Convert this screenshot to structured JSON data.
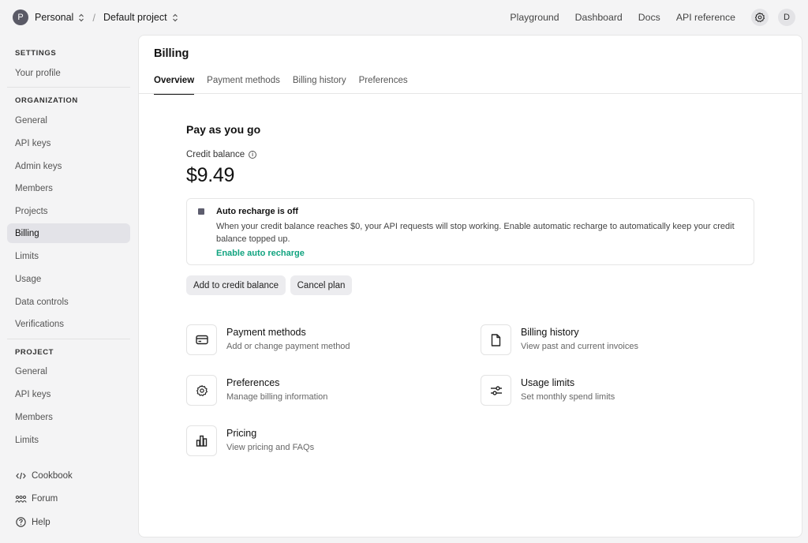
{
  "topbar": {
    "org_initial": "P",
    "org_name": "Personal",
    "project_name": "Default project",
    "crumb_separator": "/",
    "nav": [
      "Playground",
      "Dashboard",
      "Docs",
      "API reference"
    ],
    "user_initial": "D"
  },
  "sidebar": {
    "settings_heading": "SETTINGS",
    "your_profile": "Your profile",
    "organization_heading": "ORGANIZATION",
    "org_items": [
      "General",
      "API keys",
      "Admin keys",
      "Members",
      "Projects",
      "Billing",
      "Limits",
      "Usage",
      "Data controls",
      "Verifications"
    ],
    "project_heading": "PROJECT",
    "project_items": [
      "General",
      "API keys",
      "Members",
      "Limits"
    ],
    "footer": [
      "Cookbook",
      "Forum",
      "Help"
    ]
  },
  "main": {
    "title": "Billing",
    "tabs": [
      "Overview",
      "Payment methods",
      "Billing history",
      "Preferences"
    ],
    "section_title": "Pay as you go",
    "credit_label": "Credit balance",
    "credit_amount": "$9.49",
    "notice": {
      "title": "Auto recharge is off",
      "text": "When your credit balance reaches $0, your API requests will stop working. Enable automatic recharge to automatically keep your credit balance topped up.",
      "link": "Enable auto recharge"
    },
    "buttons": {
      "add_credit": "Add to credit balance",
      "cancel_plan": "Cancel plan"
    },
    "cards": [
      {
        "title": "Payment methods",
        "subtitle": "Add or change payment method",
        "icon": "credit-card-icon"
      },
      {
        "title": "Billing history",
        "subtitle": "View past and current invoices",
        "icon": "document-icon"
      },
      {
        "title": "Preferences",
        "subtitle": "Manage billing information",
        "icon": "gear-icon"
      },
      {
        "title": "Usage limits",
        "subtitle": "Set monthly spend limits",
        "icon": "sliders-icon"
      },
      {
        "title": "Pricing",
        "subtitle": "View pricing and FAQs",
        "icon": "bar-chart-icon"
      }
    ]
  },
  "colors": {
    "accent_green": "#10a37f",
    "active_bg": "#e3e3e8",
    "page_bg": "#f4f4f5"
  }
}
